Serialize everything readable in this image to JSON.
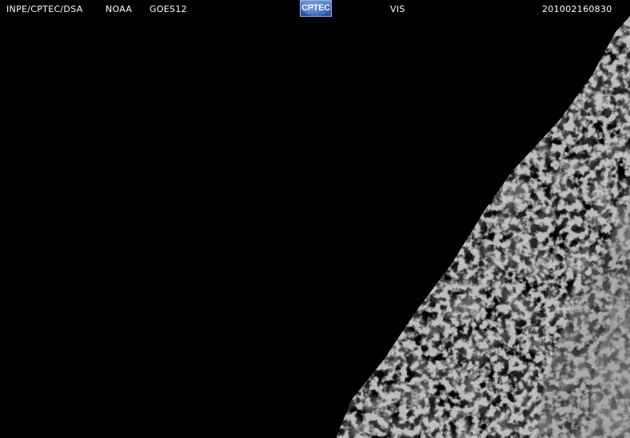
{
  "header": {
    "source": "INPE/CPTEC/DSA",
    "agency": "NOAA",
    "satellite": "GOES12",
    "logo_text": "CPTEC",
    "channel": "VIS",
    "timestamp": "201002160830"
  },
  "colors": {
    "background": "#000000",
    "text": "#ffffff",
    "logo_blue": "#3c63b3"
  }
}
